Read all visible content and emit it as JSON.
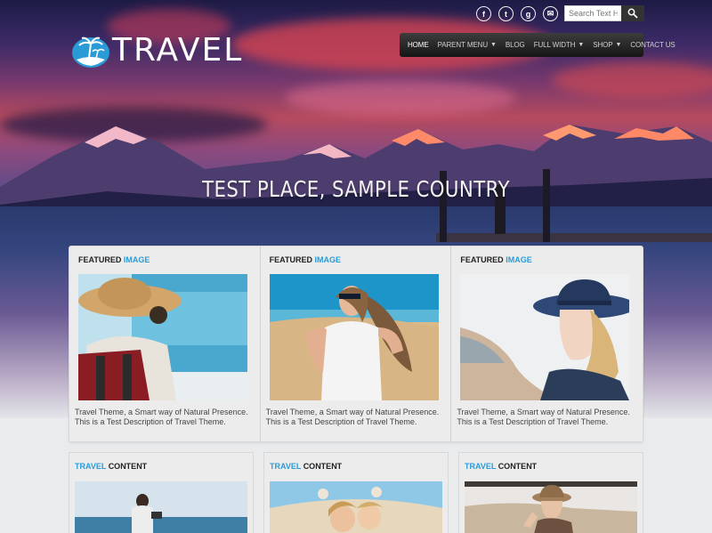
{
  "site": {
    "logo_text": "TRAVEL",
    "accent_color": "#2a9bd6"
  },
  "social": [
    {
      "name": "facebook-icon",
      "glyph": "f"
    },
    {
      "name": "twitter-icon",
      "glyph": "t"
    },
    {
      "name": "google-plus-icon",
      "glyph": "g"
    },
    {
      "name": "email-icon",
      "glyph": "✉"
    }
  ],
  "search": {
    "placeholder": "Search Text H"
  },
  "nav": {
    "items": [
      {
        "label": "Home",
        "active": true
      },
      {
        "label": "Parent Menu",
        "dropdown": true
      },
      {
        "label": "Blog"
      },
      {
        "label": "Full Width",
        "dropdown": true
      },
      {
        "label": "Shop",
        "dropdown": true
      },
      {
        "label": "Contact Us"
      }
    ]
  },
  "hero": {
    "title": "TEST PLACE, SAMPLE COUNTRY"
  },
  "featured": {
    "head_main": "FEATURED",
    "head_accent": "IMAGE",
    "items": [
      {
        "description": "Travel Theme, a Smart way of Natural Presence. This is a Test Description of Travel Theme."
      },
      {
        "description": "Travel Theme, a Smart way of Natural Presence. This is a Test Description of Travel Theme."
      },
      {
        "description": "Travel Theme, a Smart way of Natural Presence. This is a Test Description of Travel Theme."
      }
    ]
  },
  "content_cards": {
    "head_accent": "TRAVEL",
    "head_main": "CONTENT"
  }
}
